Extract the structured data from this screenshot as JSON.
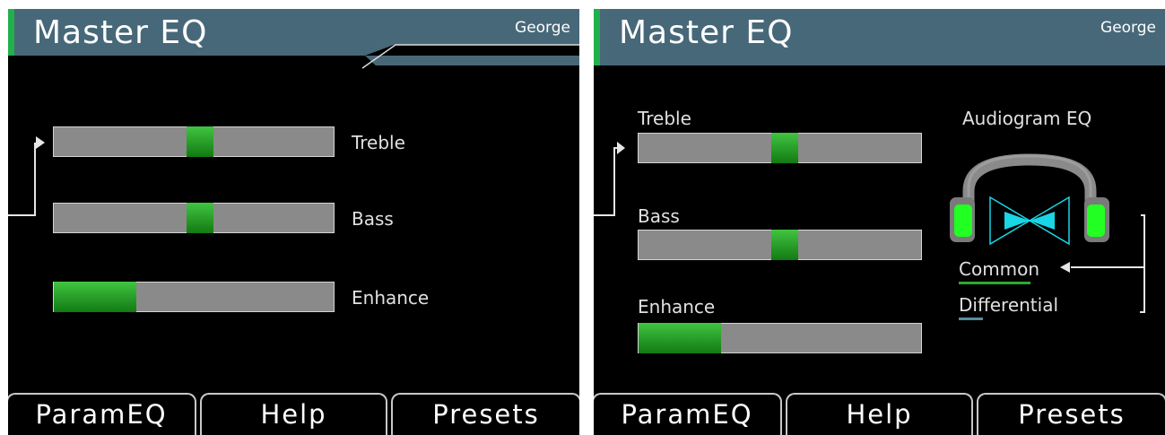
{
  "panels": [
    {
      "header": {
        "title": "Master EQ",
        "user": "George"
      },
      "sliders": [
        {
          "label": "Treble",
          "level": 0.5
        },
        {
          "label": "Bass",
          "level": 0.5
        },
        {
          "label": "Enhance",
          "level": 0.29
        }
      ],
      "footer": {
        "buttons": [
          "ParamEQ",
          "Help",
          "Presets"
        ]
      }
    },
    {
      "header": {
        "title": "Master EQ",
        "user": "George"
      },
      "sliders": [
        {
          "label": "Treble",
          "level": 0.5
        },
        {
          "label": "Bass",
          "level": 0.5
        },
        {
          "label": "Enhance",
          "level": 0.29
        }
      ],
      "audiogram": {
        "title": "Audiogram EQ",
        "options": [
          "Common",
          "Differential"
        ],
        "selected": "Common"
      },
      "footer": {
        "buttons": [
          "ParamEQ",
          "Help",
          "Presets"
        ]
      }
    }
  ],
  "colors": {
    "header_bg": "#476879",
    "accent_green": "#21b04b",
    "slider_track": "#8a8a8a",
    "slider_fill": "#2fa82f",
    "earcup_green": "#22ff22",
    "cyan": "#19d6e6"
  },
  "icons": [
    "selection-pointer-icon",
    "headphones-icon",
    "arrow-left-icon"
  ]
}
